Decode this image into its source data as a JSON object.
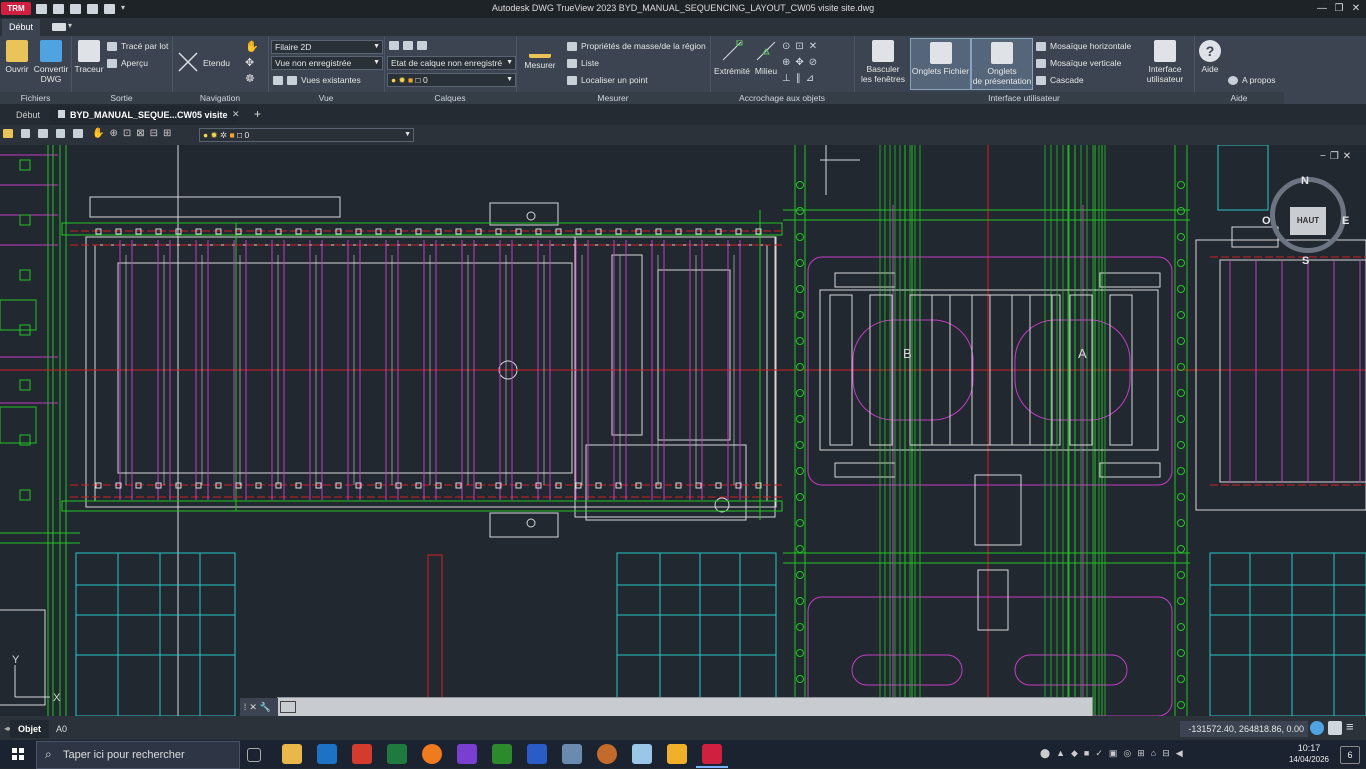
{
  "app": {
    "badge": "TRM",
    "window_title": "Autodesk DWG TrueView 2023    BYD_MANUAL_SEQUENCING_LAYOUT_CW05 visite site.dwg",
    "ribbon_tab": "Début"
  },
  "ribbon": {
    "fichiers": {
      "title": "Fichiers",
      "ouvrir": "Ouvrir",
      "convertir_1": "Convertir",
      "convertir_2": "DWG"
    },
    "sortie": {
      "title": "Sortie",
      "traceur": "Traceur",
      "trace_par_lot": "Tracé par lot",
      "apercu": "Aperçu"
    },
    "navigation": {
      "title": "Navigation",
      "etendu": "Etendu"
    },
    "vue": {
      "title": "Vue",
      "style": "Filaire 2D",
      "view": "Vue non enregistrée",
      "vues_existantes": "Vues existantes"
    },
    "calques": {
      "title": "Calques",
      "state": "Etat de calque non enregistré",
      "layer": "0"
    },
    "mesurer": {
      "title": "Mesurer",
      "mesurer": "Mesurer",
      "proprietes": "Propriétés de masse/de la région",
      "liste": "Liste",
      "localiser": "Localiser un point"
    },
    "accrochage": {
      "title": "Accrochage aux objets",
      "extremite": "Extrémité",
      "milieu": "Milieu"
    },
    "interface": {
      "title": "Interface utilisateur",
      "basculer_1": "Basculer",
      "basculer_2": "les fenêtres",
      "onglets_fichier": "Onglets Fichier",
      "onglets_pres_1": "Onglets",
      "onglets_pres_2": "de présentation",
      "mosaique_h": "Mosaïque horizontale",
      "mosaique_v": "Mosaïque verticale",
      "cascade": "Cascade",
      "interface_1": "Interface",
      "interface_2": "utilisateur"
    },
    "aide": {
      "title": "Aide",
      "aide": "Aide",
      "apropos": "A propos"
    }
  },
  "doc_tabs": {
    "debut": "Début",
    "file": "BYD_MANUAL_SEQUE...CW05 visite site"
  },
  "quick_toolbar": {
    "layer": "0"
  },
  "viewcube": {
    "north": "N",
    "east": "E",
    "south": "S",
    "west": "O",
    "face": "HAUT"
  },
  "ucs": {
    "y": "Y",
    "x": "X"
  },
  "drawing_labels": {
    "a": "A",
    "b": "B"
  },
  "status": {
    "model_tab": "Objet",
    "layout_tab": "A0",
    "coords": "-131572.40, 264818.86, 0.00"
  },
  "taskbar": {
    "search_placeholder": "Taper ici pour rechercher",
    "time": "10:17",
    "date": "14/04/2026",
    "notif": "6"
  },
  "colors": {
    "canvas": "#212830",
    "ribbon": "#3b4450",
    "green": "#22c422",
    "magenta": "#c43cc4",
    "cyan": "#28c8c8",
    "red": "#d02020",
    "white": "#d8d8d8"
  }
}
